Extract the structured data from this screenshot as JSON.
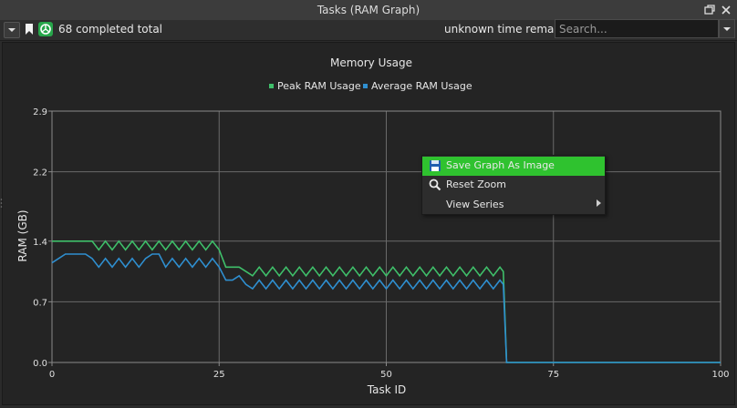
{
  "window": {
    "title": "Tasks (RAM Graph)",
    "buttons": [
      "restore-icon",
      "close-icon"
    ]
  },
  "toolbar": {
    "completed_text": "68 completed total",
    "remaining_text": "unknown time remaining",
    "search_placeholder": "Search...",
    "icons": [
      "dropdown-icon",
      "bookmark-icon",
      "pie-icon"
    ]
  },
  "colors": {
    "peak": "#3fbf6a",
    "average": "#2f8fd0",
    "highlight": "#2fc22f",
    "grid": "#6a6a6a"
  },
  "context_menu": {
    "items": [
      {
        "label": "Save Graph As Image",
        "icon": "save-icon",
        "highlighted": true
      },
      {
        "label": "Reset Zoom",
        "icon": "magnifier-icon",
        "highlighted": false
      },
      {
        "label": "View Series",
        "icon": "",
        "submenu": true
      }
    ]
  },
  "chart_data": {
    "type": "line",
    "title": "Memory Usage",
    "xlabel": "Task ID",
    "ylabel": "RAM (GB)",
    "xlim": [
      0,
      100
    ],
    "ylim": [
      0.0,
      2.9
    ],
    "xticks": [
      "0",
      "25",
      "50",
      "75",
      "100"
    ],
    "yticks": [
      "0.0",
      "0.7",
      "1.4",
      "2.2",
      "2.9"
    ],
    "grid": true,
    "legend": "top-center",
    "series": [
      {
        "name": "Peak RAM Usage",
        "color": "#3fbf6a",
        "points": [
          [
            0,
            1.4
          ],
          [
            1,
            1.4
          ],
          [
            2,
            1.4
          ],
          [
            3,
            1.4
          ],
          [
            4,
            1.4
          ],
          [
            5,
            1.4
          ],
          [
            6,
            1.4
          ],
          [
            7,
            1.3
          ],
          [
            8,
            1.4
          ],
          [
            9,
            1.3
          ],
          [
            10,
            1.4
          ],
          [
            11,
            1.3
          ],
          [
            12,
            1.4
          ],
          [
            13,
            1.3
          ],
          [
            14,
            1.4
          ],
          [
            15,
            1.3
          ],
          [
            16,
            1.4
          ],
          [
            17,
            1.3
          ],
          [
            18,
            1.4
          ],
          [
            19,
            1.3
          ],
          [
            20,
            1.4
          ],
          [
            21,
            1.3
          ],
          [
            22,
            1.4
          ],
          [
            23,
            1.3
          ],
          [
            24,
            1.4
          ],
          [
            25,
            1.3
          ],
          [
            26,
            1.1
          ],
          [
            27,
            1.1
          ],
          [
            28,
            1.1
          ],
          [
            29,
            1.05
          ],
          [
            30,
            1.0
          ],
          [
            31,
            1.1
          ],
          [
            32,
            1.0
          ],
          [
            33,
            1.1
          ],
          [
            34,
            1.0
          ],
          [
            35,
            1.1
          ],
          [
            36,
            1.0
          ],
          [
            37,
            1.1
          ],
          [
            38,
            1.0
          ],
          [
            39,
            1.1
          ],
          [
            40,
            1.0
          ],
          [
            41,
            1.1
          ],
          [
            42,
            1.0
          ],
          [
            43,
            1.1
          ],
          [
            44,
            1.0
          ],
          [
            45,
            1.1
          ],
          [
            46,
            1.0
          ],
          [
            47,
            1.1
          ],
          [
            48,
            1.0
          ],
          [
            49,
            1.1
          ],
          [
            50,
            1.0
          ],
          [
            51,
            1.1
          ],
          [
            52,
            1.0
          ],
          [
            53,
            1.1
          ],
          [
            54,
            1.0
          ],
          [
            55,
            1.1
          ],
          [
            56,
            1.0
          ],
          [
            57,
            1.1
          ],
          [
            58,
            1.0
          ],
          [
            59,
            1.1
          ],
          [
            60,
            1.0
          ],
          [
            61,
            1.1
          ],
          [
            62,
            1.0
          ],
          [
            63,
            1.1
          ],
          [
            64,
            1.0
          ],
          [
            65,
            1.1
          ],
          [
            66,
            1.0
          ],
          [
            67,
            1.1
          ],
          [
            67.5,
            1.05
          ],
          [
            68,
            0.0
          ],
          [
            100,
            0.0
          ]
        ]
      },
      {
        "name": "Average RAM Usage",
        "color": "#2f8fd0",
        "points": [
          [
            0,
            1.15
          ],
          [
            1,
            1.2
          ],
          [
            2,
            1.25
          ],
          [
            3,
            1.25
          ],
          [
            4,
            1.25
          ],
          [
            5,
            1.25
          ],
          [
            6,
            1.2
          ],
          [
            7,
            1.1
          ],
          [
            8,
            1.2
          ],
          [
            9,
            1.1
          ],
          [
            10,
            1.2
          ],
          [
            11,
            1.1
          ],
          [
            12,
            1.2
          ],
          [
            13,
            1.1
          ],
          [
            14,
            1.2
          ],
          [
            15,
            1.25
          ],
          [
            16,
            1.25
          ],
          [
            17,
            1.1
          ],
          [
            18,
            1.2
          ],
          [
            19,
            1.1
          ],
          [
            20,
            1.2
          ],
          [
            21,
            1.1
          ],
          [
            22,
            1.2
          ],
          [
            23,
            1.1
          ],
          [
            24,
            1.2
          ],
          [
            25,
            1.1
          ],
          [
            26,
            0.95
          ],
          [
            27,
            0.95
          ],
          [
            28,
            1.0
          ],
          [
            29,
            0.9
          ],
          [
            30,
            0.85
          ],
          [
            31,
            0.95
          ],
          [
            32,
            0.85
          ],
          [
            33,
            0.95
          ],
          [
            34,
            0.85
          ],
          [
            35,
            0.95
          ],
          [
            36,
            0.85
          ],
          [
            37,
            0.95
          ],
          [
            38,
            0.85
          ],
          [
            39,
            0.95
          ],
          [
            40,
            0.85
          ],
          [
            41,
            0.95
          ],
          [
            42,
            0.85
          ],
          [
            43,
            0.95
          ],
          [
            44,
            0.85
          ],
          [
            45,
            0.95
          ],
          [
            46,
            0.85
          ],
          [
            47,
            0.95
          ],
          [
            48,
            0.85
          ],
          [
            49,
            0.95
          ],
          [
            50,
            0.85
          ],
          [
            51,
            0.95
          ],
          [
            52,
            0.85
          ],
          [
            53,
            0.95
          ],
          [
            54,
            0.85
          ],
          [
            55,
            0.95
          ],
          [
            56,
            0.85
          ],
          [
            57,
            0.95
          ],
          [
            58,
            0.85
          ],
          [
            59,
            0.95
          ],
          [
            60,
            0.85
          ],
          [
            61,
            0.95
          ],
          [
            62,
            0.85
          ],
          [
            63,
            0.95
          ],
          [
            64,
            0.85
          ],
          [
            65,
            0.95
          ],
          [
            66,
            0.85
          ],
          [
            67,
            0.95
          ],
          [
            67.5,
            0.9
          ],
          [
            68,
            0.0
          ],
          [
            100,
            0.0
          ]
        ]
      }
    ]
  }
}
